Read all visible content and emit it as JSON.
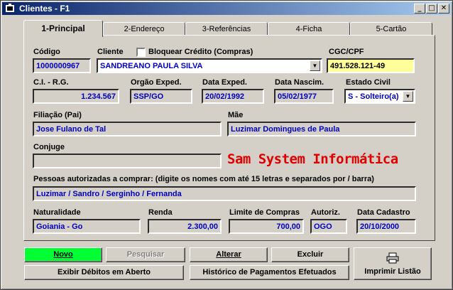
{
  "window": {
    "title": "Clientes - F1"
  },
  "tabs": [
    {
      "label": "1-Principal"
    },
    {
      "label": "2-Endereço"
    },
    {
      "label": "3-Referências"
    },
    {
      "label": "4-Ficha"
    },
    {
      "label": "5-Cartão"
    }
  ],
  "form": {
    "codigo_label": "Código",
    "codigo_value": "1000000967",
    "cliente_label": "Cliente",
    "bloquear_label": "Bloquear Crédito (Compras)",
    "cliente_value": "SANDREANO PAULA SILVA",
    "cgc_label": "CGC/CPF",
    "cgc_value": "491.528.121-49",
    "ci_label": "C.I. - R.G.",
    "ci_value": "1.234.567",
    "orgao_label": "Orgão Exped.",
    "orgao_value": "SSP/GO",
    "data_exped_label": "Data Exped.",
    "data_exped_value": "20/02/1992",
    "data_nasc_label": "Data Nascim.",
    "data_nasc_value": "05/02/1977",
    "estado_civil_label": "Estado Civil",
    "estado_civil_value": "S - Solteiro(a)",
    "filiacao_label": "Filiação (Pai)",
    "filiacao_value": "Jose Fulano de Tal",
    "mae_label": "Mãe",
    "mae_value": "Luzimar Domingues de Paula",
    "conjuge_label": "Conjuge",
    "conjuge_value": "",
    "brand_text": "Sam System Informática",
    "autorizadas_label": "Pessoas autorizadas a comprar: (digite os nomes com até 15 letras e separados por / barra)",
    "autorizadas_value": "Luzimar / Sandro / Serginho / Fernanda",
    "naturalidade_label": "Naturalidade",
    "naturalidade_value": "Goiania - Go",
    "renda_label": "Renda",
    "renda_value": "2.300,00",
    "limite_label": "Limite de Compras",
    "limite_value": "700,00",
    "autoriz_label": "Autoriz.",
    "autoriz_value": "OGO",
    "data_cadastro_label": "Data Cadastro",
    "data_cadastro_value": "20/10/2000"
  },
  "buttons": {
    "novo": "Novo",
    "pesquisar": "Pesquisar",
    "alterar": "Alterar",
    "excluir": "Excluir",
    "debitos": "Exibir Débitos em Aberto",
    "historico": "Histórico de Pagamentos Efetuados",
    "imprimir": "Imprimir Listão"
  },
  "colors": {
    "title_start": "#0a246a",
    "field_text": "#0000c0",
    "brand": "#e00000",
    "novo_bg": "#00ff33",
    "cgc_bg": "#ffff99"
  }
}
